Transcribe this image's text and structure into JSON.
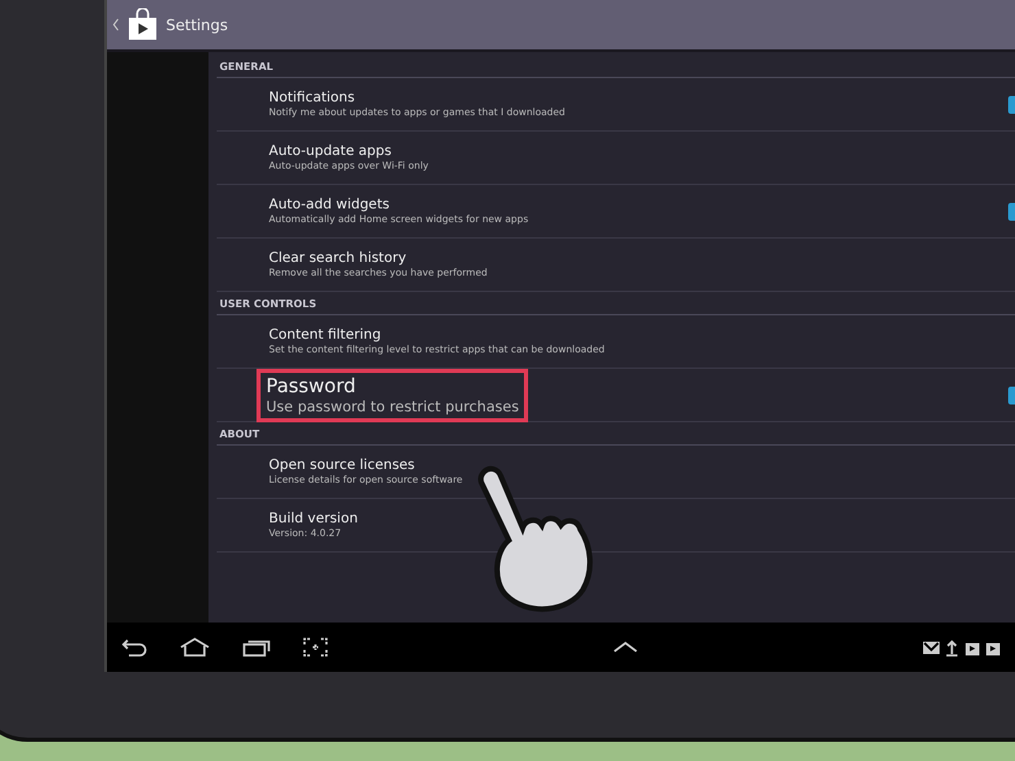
{
  "action_bar": {
    "title": "Settings"
  },
  "sections": [
    {
      "header": "GENERAL",
      "items": [
        {
          "kind": "checkbox",
          "title": "Notifications",
          "summary": "Notify me about updates to apps or games that I downloaded",
          "checked": true,
          "highlighted": false
        },
        {
          "kind": "plain",
          "title": "Auto-update apps",
          "summary": "Auto-update apps over Wi-Fi only",
          "highlighted": false
        },
        {
          "kind": "checkbox",
          "title": "Auto-add widgets",
          "summary": "Automatically add Home screen widgets for new apps",
          "checked": true,
          "highlighted": false
        },
        {
          "kind": "plain",
          "title": "Clear search history",
          "summary": "Remove all the searches you have performed",
          "highlighted": false
        }
      ]
    },
    {
      "header": "USER CONTROLS",
      "items": [
        {
          "kind": "plain",
          "title": "Content filtering",
          "summary": "Set the content filtering level to restrict apps that can be downloaded",
          "highlighted": false
        },
        {
          "kind": "checkbox",
          "title": "Password",
          "summary": "Use password to restrict purchases",
          "checked": true,
          "highlighted": true
        }
      ]
    },
    {
      "header": "ABOUT",
      "items": [
        {
          "kind": "plain",
          "title": "Open source licenses",
          "summary": "License details for open source software",
          "highlighted": false
        },
        {
          "kind": "plain",
          "title": "Build version",
          "summary": "Version: 4.0.27",
          "highlighted": false
        }
      ]
    }
  ]
}
